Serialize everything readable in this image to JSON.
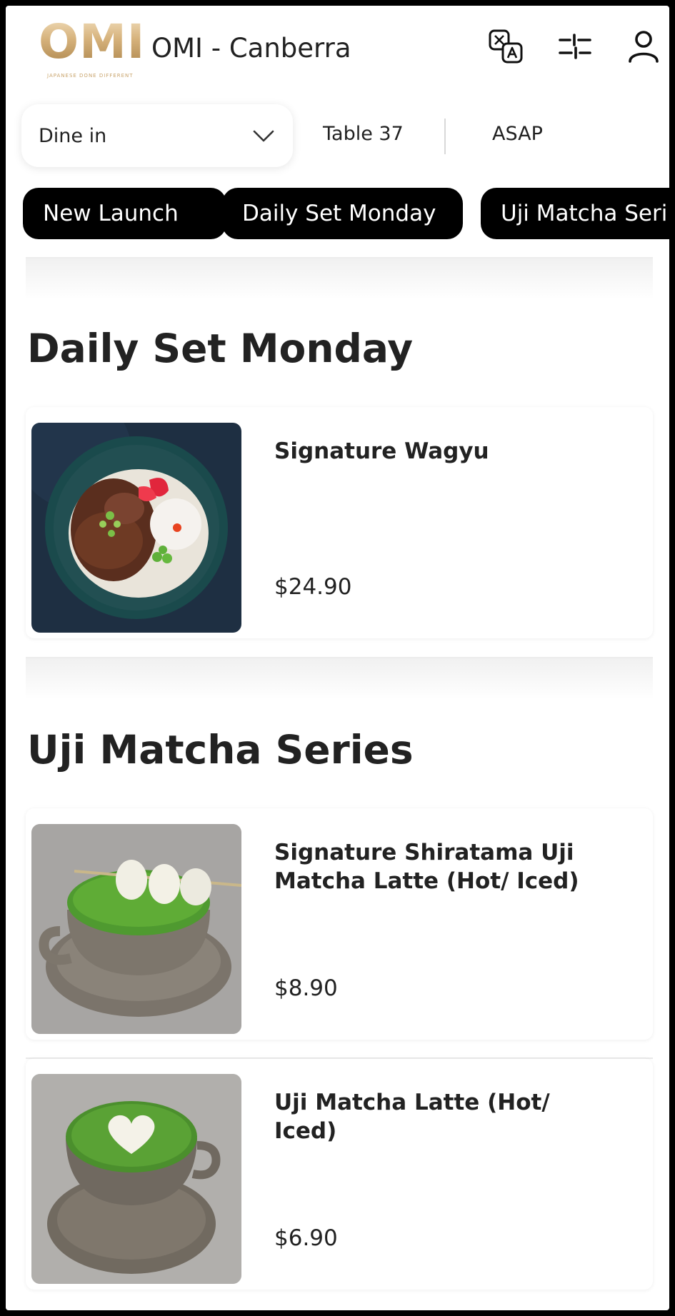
{
  "header": {
    "logo_text": "OMI",
    "logo_tagline": "JAPANESE DONE DIFFERENT",
    "store_name": "OMI - Canberra",
    "icons": [
      "translate-icon",
      "filter-sliders-icon",
      "user-account-icon"
    ]
  },
  "order": {
    "type_label": "Dine in",
    "table_label": "Table 37",
    "time_label": "ASAP"
  },
  "categories": [
    "New Launch",
    "Daily Set Monday",
    "Uji Matcha Seri"
  ],
  "sections": [
    {
      "title": "Daily Set Monday",
      "items": [
        {
          "name": "Signature Wagyu",
          "price": "$24.90"
        }
      ]
    },
    {
      "title": "Uji Matcha Series",
      "items": [
        {
          "name": "Signature Shiratama Uji Matcha Latte (Hot/ Iced)",
          "price": "$8.90"
        },
        {
          "name": "Uji Matcha Latte (Hot/ Iced)",
          "price": "$6.90"
        }
      ]
    }
  ],
  "colors": {
    "chip_background": "#000000",
    "chip_text": "#ffffff",
    "logo_gold": "#c9a46c",
    "text": "#222222"
  }
}
